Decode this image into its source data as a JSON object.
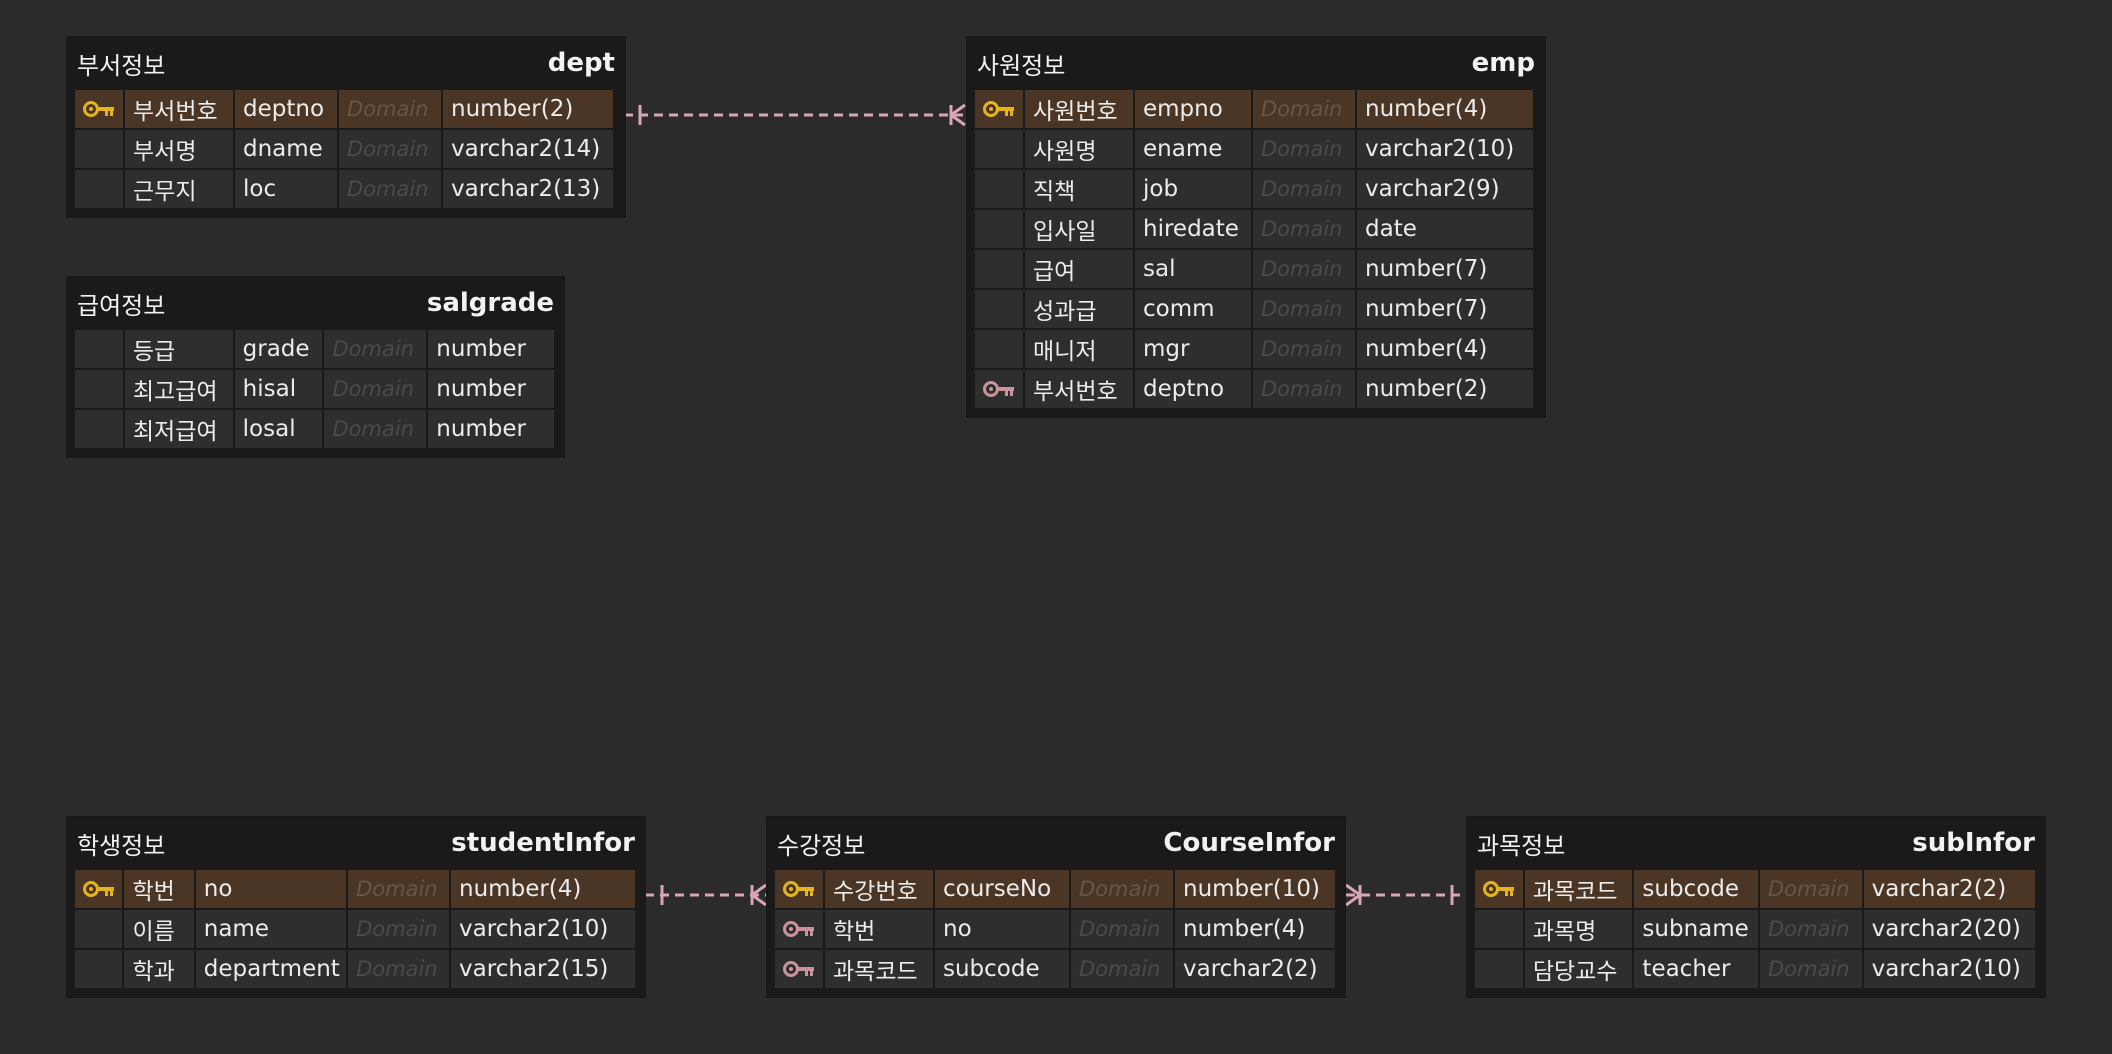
{
  "colors": {
    "background": "#2b2b2b",
    "entity": "#1a1a1a",
    "cell": "#2e2e2e",
    "pk_row": "#4b3625",
    "pk_key": "#e5b41c",
    "fk_key": "#c8939c",
    "relation": "#d9a6b6"
  },
  "entities": [
    {
      "id": "dept",
      "logical_name": "부서정보",
      "physical_name": "dept",
      "columns": [
        {
          "key": "pk",
          "logical": "부서번호",
          "physical": "deptno",
          "domain": "Domain",
          "type": "number(2)"
        },
        {
          "key": "",
          "logical": "부서명",
          "physical": "dname",
          "domain": "Domain",
          "type": "varchar2(14)"
        },
        {
          "key": "",
          "logical": "근무지",
          "physical": "loc",
          "domain": "Domain",
          "type": "varchar2(13)"
        }
      ]
    },
    {
      "id": "salgrade",
      "logical_name": "급여정보",
      "physical_name": "salgrade",
      "columns": [
        {
          "key": "",
          "logical": "등급",
          "physical": "grade",
          "domain": "Domain",
          "type": "number"
        },
        {
          "key": "",
          "logical": "최고급여",
          "physical": "hisal",
          "domain": "Domain",
          "type": "number"
        },
        {
          "key": "",
          "logical": "최저급여",
          "physical": "losal",
          "domain": "Domain",
          "type": "number"
        }
      ]
    },
    {
      "id": "emp",
      "logical_name": "사원정보",
      "physical_name": "emp",
      "columns": [
        {
          "key": "pk",
          "logical": "사원번호",
          "physical": "empno",
          "domain": "Domain",
          "type": "number(4)"
        },
        {
          "key": "",
          "logical": "사원명",
          "physical": "ename",
          "domain": "Domain",
          "type": "varchar2(10)"
        },
        {
          "key": "",
          "logical": "직책",
          "physical": "job",
          "domain": "Domain",
          "type": "varchar2(9)"
        },
        {
          "key": "",
          "logical": "입사일",
          "physical": "hiredate",
          "domain": "Domain",
          "type": "date"
        },
        {
          "key": "",
          "logical": "급여",
          "physical": "sal",
          "domain": "Domain",
          "type": "number(7)"
        },
        {
          "key": "",
          "logical": "성과급",
          "physical": "comm",
          "domain": "Domain",
          "type": "number(7)"
        },
        {
          "key": "",
          "logical": "매니저",
          "physical": "mgr",
          "domain": "Domain",
          "type": "number(4)"
        },
        {
          "key": "fk",
          "logical": "부서번호",
          "physical": "deptno",
          "domain": "Domain",
          "type": "number(2)"
        }
      ]
    },
    {
      "id": "studentInfor",
      "logical_name": "학생정보",
      "physical_name": "studentInfor",
      "columns": [
        {
          "key": "pk",
          "logical": "학번",
          "physical": "no",
          "domain": "Domain",
          "type": "number(4)"
        },
        {
          "key": "",
          "logical": "이름",
          "physical": "name",
          "domain": "Domain",
          "type": "varchar2(10)"
        },
        {
          "key": "",
          "logical": "학과",
          "physical": "department",
          "domain": "Domain",
          "type": "varchar2(15)"
        }
      ]
    },
    {
      "id": "CourseInfor",
      "logical_name": "수강정보",
      "physical_name": "CourseInfor",
      "columns": [
        {
          "key": "pk",
          "logical": "수강번호",
          "physical": "courseNo",
          "domain": "Domain",
          "type": "number(10)"
        },
        {
          "key": "fk",
          "logical": "학번",
          "physical": "no",
          "domain": "Domain",
          "type": "number(4)"
        },
        {
          "key": "fk",
          "logical": "과목코드",
          "physical": "subcode",
          "domain": "Domain",
          "type": "varchar2(2)"
        }
      ]
    },
    {
      "id": "subInfor",
      "logical_name": "과목정보",
      "physical_name": "subInfor",
      "columns": [
        {
          "key": "pk",
          "logical": "과목코드",
          "physical": "subcode",
          "domain": "Domain",
          "type": "varchar2(2)"
        },
        {
          "key": "",
          "logical": "과목명",
          "physical": "subname",
          "domain": "Domain",
          "type": "varchar2(20)"
        },
        {
          "key": "",
          "logical": "담당교수",
          "physical": "teacher",
          "domain": "Domain",
          "type": "varchar2(10)"
        }
      ]
    }
  ],
  "relations": [
    {
      "from": "dept",
      "to": "emp",
      "style": "one-to-many"
    },
    {
      "from": "studentInfor",
      "to": "CourseInfor",
      "style": "one-to-many"
    },
    {
      "from": "subInfor",
      "to": "CourseInfor",
      "style": "one-to-many"
    }
  ]
}
